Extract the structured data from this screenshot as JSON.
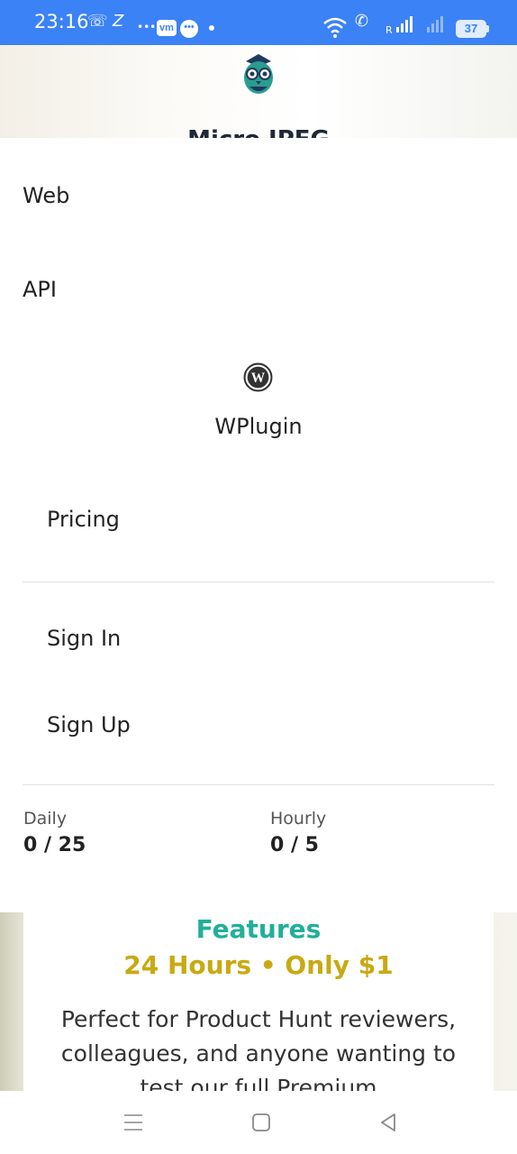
{
  "status_bar": {
    "time": "23:16",
    "battery": "37",
    "vm_badge": "vm",
    "accent_color": "#3b82f6"
  },
  "header": {
    "site_title": "Micro JPEG"
  },
  "menu": {
    "web": "Web",
    "api": "API",
    "wplugin": "WPlugin",
    "pricing": "Pricing",
    "sign_in": "Sign In",
    "sign_up": "Sign Up"
  },
  "usage": {
    "daily_label": "Daily",
    "daily_value": "0 / 25",
    "hourly_label": "Hourly",
    "hourly_value": "0 / 5"
  },
  "content": {
    "features_title": "Features",
    "features_subtitle": "24 Hours • Only $1",
    "features_description": "Perfect for Product Hunt reviewers, colleagues, and anyone wanting to test our full Premium",
    "title_color": "#20b09a",
    "subtitle_color": "#c9a912"
  },
  "icons": [
    "owl-logo-icon",
    "wordpress-icon",
    "menu-lines-icon",
    "home-square-icon",
    "back-triangle-icon"
  ]
}
